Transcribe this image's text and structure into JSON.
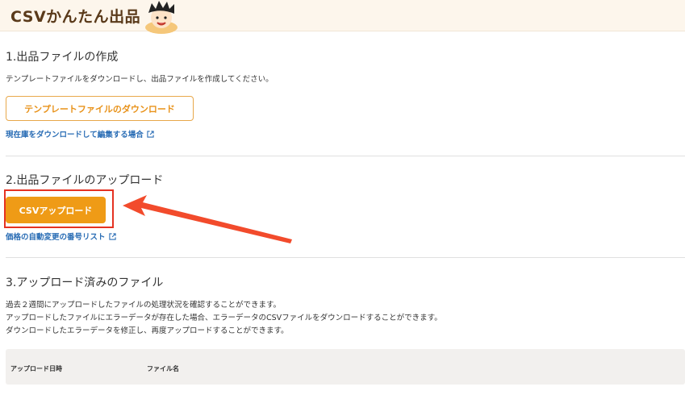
{
  "header": {
    "title": "CSVかんたん出品",
    "mascot_icon": "mascot-icon"
  },
  "section1": {
    "title": "1.出品ファイルの作成",
    "description": "テンプレートファイルをダウンロードし、出品ファイルを作成してください。",
    "download_button": "テンプレートファイルのダウンロード",
    "link": "現在庫をダウンロードして編集する場合"
  },
  "section2": {
    "title": "2.出品ファイルのアップロード",
    "upload_button": "CSVアップロード",
    "link": "価格の自動変更の番号リスト"
  },
  "section3": {
    "title": "3.アップロード済みのファイル",
    "description_lines": [
      "過去２週間にアップロードしたファイルの処理状況を確認することができます。",
      "アップロードしたファイルにエラーデータが存在した場合、エラーデータのCSVファイルをダウンロードすることができます。",
      "ダウンロードしたエラーデータを修正し、再度アップロードすることができます。"
    ],
    "table_headers": [
      "アップロード日時",
      "ファイル名"
    ]
  },
  "colors": {
    "accent": "#ef9b16",
    "link": "#2a6db5",
    "annotation": "#e53222"
  }
}
